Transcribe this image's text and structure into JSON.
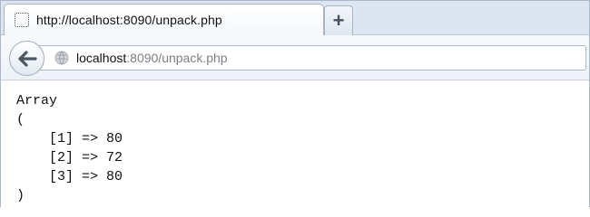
{
  "tab": {
    "title": "http://localhost:8090/unpack.php",
    "new_tab_label": "+"
  },
  "toolbar": {
    "url_host": "localhost",
    "url_rest": ":8090/unpack.php"
  },
  "content": {
    "lines": [
      "Array",
      "(",
      "    [1] => 80",
      "    [2] => 72",
      "    [3] => 80",
      ")"
    ]
  },
  "colors": {
    "tabstrip": "#dbe6f2",
    "url_muted": "#7b7f85",
    "text": "#111111"
  },
  "icons": {
    "favicon": "dotted-page-icon",
    "back": "back-arrow-icon",
    "site": "globe-icon"
  }
}
